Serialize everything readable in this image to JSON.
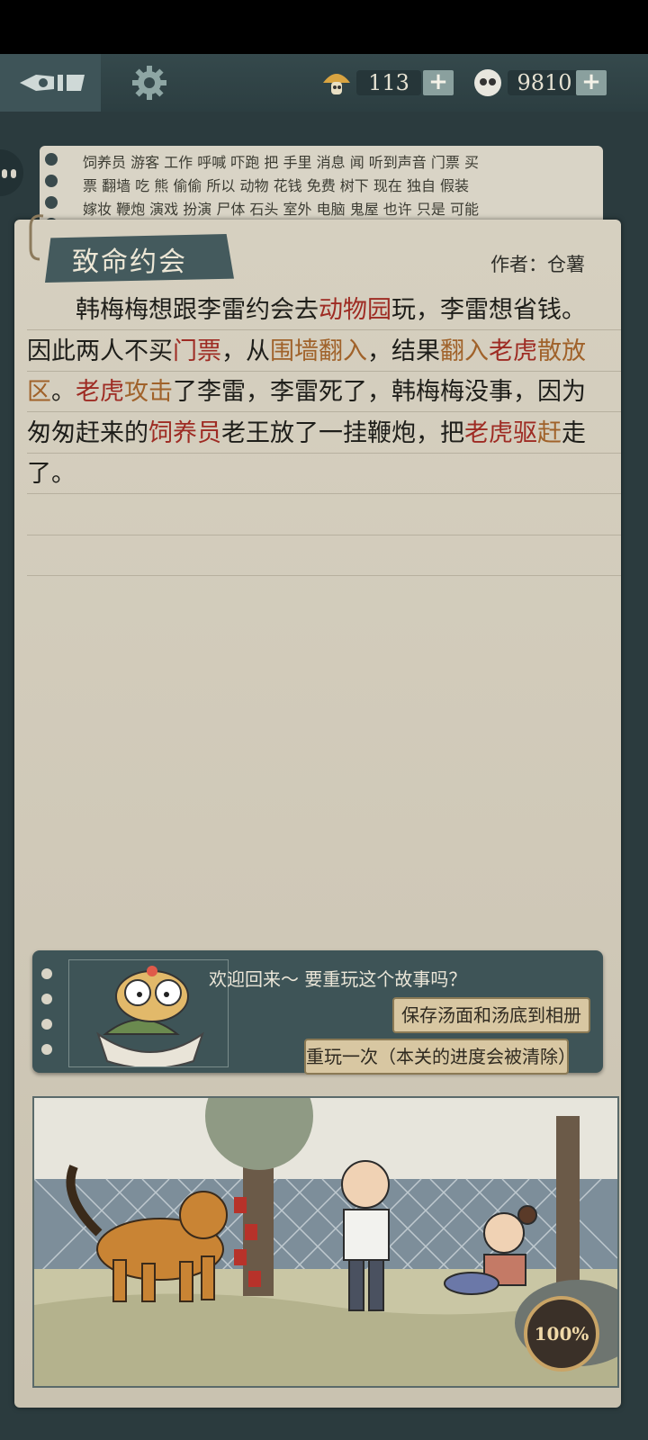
{
  "currency": {
    "mushroom_count": "113",
    "gem_count": "9810",
    "plus_label": "+"
  },
  "background_words": {
    "line1": "饲养员 游客 工作 呼喊 吓跑 把 手里 消息 闻 听到声音 门票 买",
    "line2": "票 翻墙 吃 熊 偷偷 所以 动物 花钱 免费 树下 现在 独自 假装",
    "line3": "嫁妆 鞭炮 演戏 扮演 尸体 石头 室外 电脑 鬼屋 也许 只是 可能"
  },
  "story": {
    "title": "致命约会",
    "author": "作者：仓薯",
    "segments": [
      {
        "t": "韩梅梅想跟李雷约会去",
        "c": ""
      },
      {
        "t": "动物园",
        "c": "red"
      },
      {
        "t": "玩，李雷想省钱。因此两人不买",
        "c": ""
      },
      {
        "t": "门票",
        "c": "red"
      },
      {
        "t": "，从",
        "c": ""
      },
      {
        "t": "围墙翻入",
        "c": "orange"
      },
      {
        "t": "，结果",
        "c": ""
      },
      {
        "t": "翻入",
        "c": "orange"
      },
      {
        "t": "老虎",
        "c": "red"
      },
      {
        "t": "散放区",
        "c": "orange"
      },
      {
        "t": "。",
        "c": ""
      },
      {
        "t": "老虎",
        "c": "red"
      },
      {
        "t": "攻击",
        "c": "orange"
      },
      {
        "t": "了李雷，李雷死了，韩梅梅没事，因为匆匆赶来的",
        "c": ""
      },
      {
        "t": "饲养员",
        "c": "red"
      },
      {
        "t": "老王放了一挂鞭炮，把",
        "c": ""
      },
      {
        "t": "老虎",
        "c": "red"
      },
      {
        "t": "驱",
        "c": "red"
      },
      {
        "t": "赶",
        "c": "orange"
      },
      {
        "t": "走了。",
        "c": ""
      }
    ]
  },
  "dialog": {
    "welcome": "欢迎回来～ 要重玩这个故事吗？",
    "save_button": "保存汤面和汤底到相册",
    "replay_button": "重玩一次（本关的进度会被清除）"
  },
  "scene": {
    "progress": "100%"
  },
  "colors": {
    "accent_red": "#9e2b23",
    "accent_orange": "#a0622a",
    "panel": "#3e5457"
  }
}
